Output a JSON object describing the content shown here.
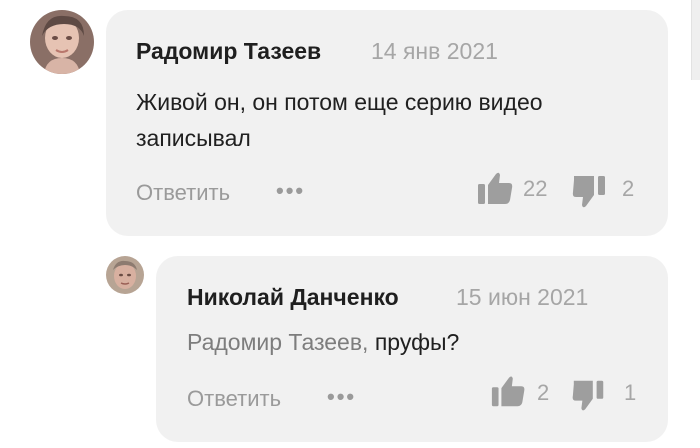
{
  "comments": [
    {
      "author": "Радомир Тазеев",
      "date": "14 янв 2021",
      "text_line1": "Живой он, он потом еще серию видео",
      "text_line2": "записывал",
      "reply_label": "Ответить",
      "more_label": "•••",
      "likes": "22",
      "dislikes": "2"
    },
    {
      "author": "Николай Данченко",
      "date": "15 июн 2021",
      "mention": "Радомир Тазеев,",
      "text": " пруфы?",
      "reply_label": "Ответить",
      "more_label": "•••",
      "likes": "2",
      "dislikes": "1"
    }
  ],
  "colors": {
    "bubble": "#f1f1f1",
    "author": "#1f1f1f",
    "meta": "#a6a6a6",
    "icon": "#9e9e9e"
  },
  "icons": [
    "avatar",
    "thumbs-up-icon",
    "thumbs-down-icon",
    "more-icon"
  ]
}
